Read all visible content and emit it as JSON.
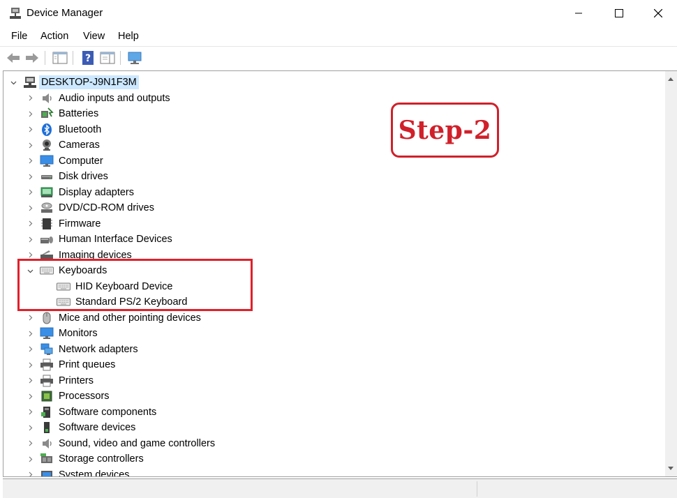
{
  "window": {
    "title": "Device Manager",
    "icon": "device-manager-icon"
  },
  "menu": [
    "File",
    "Action",
    "View",
    "Help"
  ],
  "toolbar": [
    "back-icon",
    "forward-icon",
    "show-hide-tree-icon",
    "help-icon",
    "properties-icon",
    "scan-hardware-icon"
  ],
  "tree": {
    "root": {
      "label": "DESKTOP-J9N1F3M",
      "icon": "computer-icon",
      "expanded": true
    },
    "categories": [
      {
        "label": "Audio inputs and outputs",
        "icon": "speaker-icon"
      },
      {
        "label": "Batteries",
        "icon": "battery-icon"
      },
      {
        "label": "Bluetooth",
        "icon": "bluetooth-icon"
      },
      {
        "label": "Cameras",
        "icon": "camera-icon"
      },
      {
        "label": "Computer",
        "icon": "monitor-icon"
      },
      {
        "label": "Disk drives",
        "icon": "disk-drive-icon"
      },
      {
        "label": "Display adapters",
        "icon": "display-adapter-icon"
      },
      {
        "label": "DVD/CD-ROM drives",
        "icon": "dvd-drive-icon"
      },
      {
        "label": "Firmware",
        "icon": "firmware-chip-icon"
      },
      {
        "label": "Human Interface Devices",
        "icon": "hid-icon"
      },
      {
        "label": "Imaging devices",
        "icon": "scanner-icon"
      },
      {
        "label": "Keyboards",
        "icon": "keyboard-icon",
        "expanded": true,
        "children": [
          {
            "label": "HID Keyboard Device",
            "icon": "keyboard-icon"
          },
          {
            "label": "Standard PS/2 Keyboard",
            "icon": "keyboard-icon"
          }
        ]
      },
      {
        "label": "Mice and other pointing devices",
        "icon": "mouse-icon"
      },
      {
        "label": "Monitors",
        "icon": "monitor-icon"
      },
      {
        "label": "Network adapters",
        "icon": "network-icon"
      },
      {
        "label": "Print queues",
        "icon": "printer-icon"
      },
      {
        "label": "Printers",
        "icon": "printer-icon"
      },
      {
        "label": "Processors",
        "icon": "processor-icon"
      },
      {
        "label": "Software components",
        "icon": "software-component-icon"
      },
      {
        "label": "Software devices",
        "icon": "software-device-icon"
      },
      {
        "label": "Sound, video and game controllers",
        "icon": "speaker-icon"
      },
      {
        "label": "Storage controllers",
        "icon": "storage-controller-icon"
      },
      {
        "label": "System devices",
        "icon": "system-device-icon"
      }
    ]
  },
  "annotation": {
    "step_label": "Step-2",
    "highlight_color": "#e0202a"
  },
  "colors": {
    "selection": "#cce8ff",
    "accent": "#0078d7"
  }
}
